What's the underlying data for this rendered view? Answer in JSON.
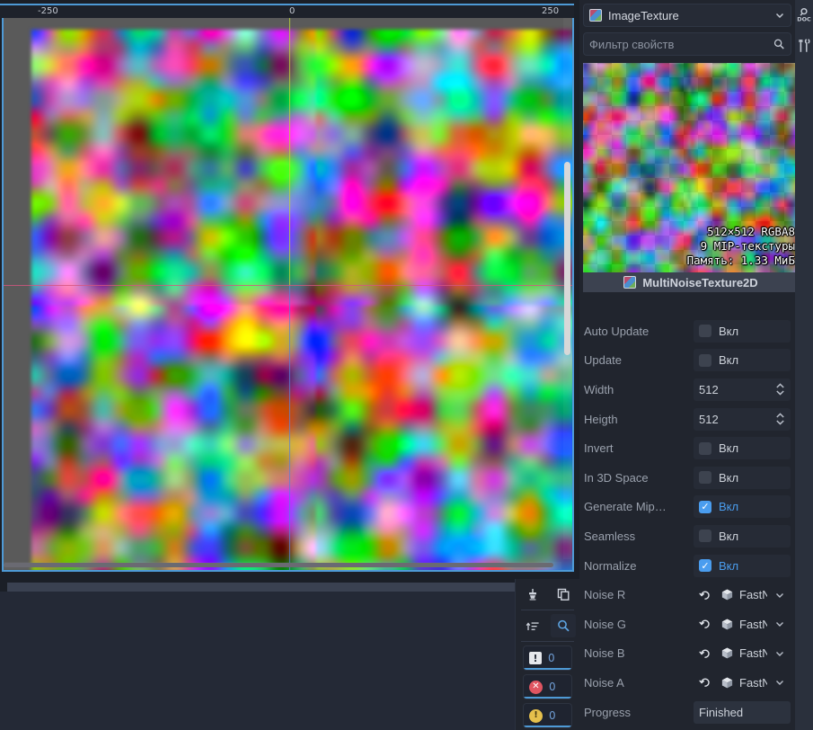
{
  "viewport": {
    "ruler": {
      "labels": [
        "-250",
        "0",
        "250"
      ],
      "unit": "px"
    },
    "scroll": {
      "vertical_visible": true,
      "horizontal_visible": true
    },
    "guides": {
      "vertical_up_color": "#b9d43a",
      "vertical_down_color": "#5b7fd4",
      "horizontal_color": "#d6557f"
    }
  },
  "bottom_panel": {
    "toolbar": {
      "clear_icon": "broom-icon",
      "copy_icon": "copy-icon",
      "collapse_icon": "collapse-lines-icon",
      "search_icon": "search-icon"
    },
    "counters": [
      {
        "icon": "info-square-icon",
        "value": "0",
        "kind": "info"
      },
      {
        "icon": "error-circle-icon",
        "value": "0",
        "kind": "error"
      },
      {
        "icon": "warning-circle-icon",
        "value": "0",
        "kind": "warning"
      }
    ]
  },
  "inspector": {
    "type_selector": {
      "label": "ImageTexture",
      "icon": "texture-icon",
      "chevron": "chevron-down-icon"
    },
    "filter": {
      "placeholder": "Фильтр свойств",
      "value": "",
      "icon": "search-icon"
    },
    "preview": {
      "info_lines": [
        "512×512 RGBA8",
        "9 MIP-текстуры",
        "Память: 1.33 МиБ"
      ],
      "resource_name": "MultiNoiseTexture2D",
      "resource_icon": "texture-icon"
    },
    "properties": [
      {
        "label": "Auto Update",
        "type": "checkbox",
        "value_label": "Вкл",
        "checked": false
      },
      {
        "label": "Update",
        "type": "checkbox",
        "value_label": "Вкл",
        "checked": false
      },
      {
        "label": "Width",
        "type": "number",
        "value": "512"
      },
      {
        "label": "Heigth",
        "type": "number",
        "value": "512"
      },
      {
        "label": "Invert",
        "type": "checkbox",
        "value_label": "Вкл",
        "checked": false
      },
      {
        "label": "In 3D Space",
        "type": "checkbox",
        "value_label": "Вкл",
        "checked": false
      },
      {
        "label": "Generate Mip…",
        "type": "checkbox",
        "value_label": "Вкл",
        "checked": true
      },
      {
        "label": "Seamless",
        "type": "checkbox",
        "value_label": "Вкл",
        "checked": false
      },
      {
        "label": "Normalize",
        "type": "checkbox",
        "value_label": "Вкл",
        "checked": true
      },
      {
        "label": "Noise R",
        "type": "resource",
        "value": "FastNois"
      },
      {
        "label": "Noise G",
        "type": "resource",
        "value": "FastNois"
      },
      {
        "label": "Noise B",
        "type": "resource",
        "value": "FastNois"
      },
      {
        "label": "Noise A",
        "type": "resource",
        "value": "FastNois"
      },
      {
        "label": "Progress",
        "type": "readonly",
        "value": "Finished"
      }
    ]
  },
  "right_rail": {
    "doc_icon": "doc-search-icon",
    "tools_icon": "tools-icon"
  },
  "colors": {
    "accent_blue": "#4a9def",
    "panel_bg": "#21252e",
    "field_bg": "#262b36",
    "border_blue": "#4e9ad6",
    "error_red": "#e05561",
    "warning_yellow": "#e5c04c"
  }
}
